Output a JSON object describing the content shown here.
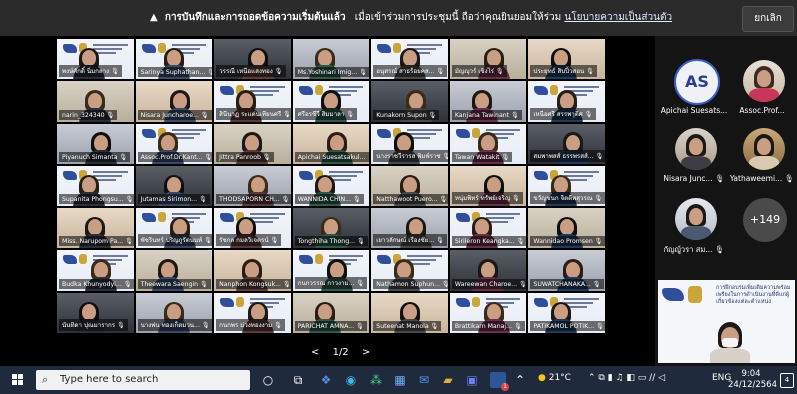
{
  "banner": {
    "warning_text": "การบันทึกและการถอดข้อความเริ่มต้นแล้ว",
    "body_text": "เมื่อเข้าร่วมการประชุมนี้ ถือว่าคุณยินยอมให้ร่วม",
    "link_text": "นโยบายความเป็นส่วนตัว",
    "dismiss_label": "ยกเลิก"
  },
  "pager": {
    "prev": "<",
    "label": "1/2",
    "next": ">"
  },
  "sidebar": {
    "participants": [
      {
        "name": "Apichai Suesats...",
        "initials": "AS",
        "kind": "initials"
      },
      {
        "name": "Assoc.Prof...",
        "kind": "photo"
      },
      {
        "name": "Nisara Junc...",
        "kind": "photo",
        "mic": "🎙"
      },
      {
        "name": "Yathaweemi...",
        "kind": "photo",
        "mic": "🎙"
      },
      {
        "name": "กัญญ์ุวรา สม...",
        "kind": "photo",
        "mic": "🎙"
      }
    ],
    "more_label": "+149",
    "presenter_slide_title": "การฝึกอบรมเพิ่มเติมความพร้อมเพรียงในการดำเนินงานที่ดีแก่ผู้เกี่ยวข้องแต่ละตำแหน่ง"
  },
  "tiles": [
    "พงษ์ศักดิ์ นิ่มกลาง",
    "Sarinya Suphathan...",
    "วรรณี  เหนือแสงทอง",
    "Ms.Yoshinari Imig...",
    "อนุสรณ์ สาธร้อยคส...",
    "มัญญุวร์ เชิงไร่",
    "ประยุทธ์  สิบปิ้วสอน",
    "narin_324340",
    "Nisara Juncharoe...",
    "สินีนาฏ ระแด่นเทียนศรี",
    "ศรีอรชีวี สิมมาลา",
    "Kunakorn Supon",
    "Kanjana Tawinant",
    "เหนือศรี สรรพาุดิศ",
    "Piyanuch Simanta",
    "Assoc.Prof.Dr.Kant...",
    "Jittra Panroob",
    "Apichai Suesatsakul...",
    "นางราชวีรารส พิมพ์ราช",
    "Tawan Watakit",
    "สมพาพสส์  ธรรพรสส์...",
    "Supanita Phongsu...",
    "Jutamas Sirimon...",
    "THODSAPORN CH...",
    "WANNIDA  CHIN...",
    "Natthawoot Puero...",
    "หนุ่มพิทร์ ทรัพย์เจริญ",
    "ขวัญชนก  จิตตีพสุวรณ",
    "Miss. Narupom Pa...",
    "พัชรินทร์  ปริญภูรัตนนท์",
    "รัชกล  กมลวิเจตรน์",
    "Tongthiha Thong...",
    "เยาวลักษณ์  เรืองชัย...",
    "Sirileron Keangka...",
    "Wannidao Promsen",
    "Budka Khunyodyi...",
    "Theewara Saengin",
    "Nanphon Kongsuk...",
    "กนกวรรณ  กาวงาม...",
    "Nathamon Suphun...",
    "Wareewan Charoe...",
    "SUWATCHANAKA...",
    "นันทิดา  ปุณมารากร",
    "นางพ่น  ทองเก็ตมวน...",
    "กนกพร  ม่วงทองงาม",
    "PARICHAT  AMNA...",
    "Suteenat Manola",
    "Brattikarn Manaj...",
    "PATIKAMOL POTIK..."
  ],
  "taskbar": {
    "search_placeholder": "Type here to search",
    "weather": "21°C",
    "language": "ENG",
    "time": "9:04",
    "date": "24/12/2564",
    "notification_count": "4",
    "word_badge": "1"
  },
  "colors": {
    "banner_bg": "#2b2b2b",
    "taskbar_bg": "#1f2a3d",
    "avatar_border": "#3a5fc7"
  }
}
